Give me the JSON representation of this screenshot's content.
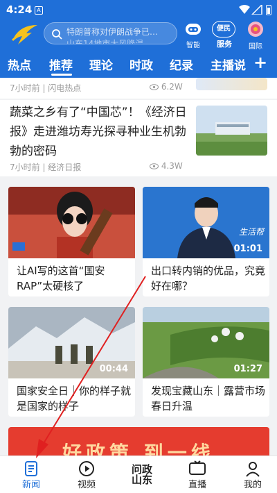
{
  "status_bar": {
    "time": "4:24",
    "notification_glyph": "A"
  },
  "header": {
    "search_placeholder": "特朗普称对伊朗战争已…",
    "search_placeholder_line2": "山东14地市大风降温…",
    "shortcuts": [
      {
        "label": "智能",
        "icon": "robot-icon"
      },
      {
        "label": "服务",
        "badge_text": "便民",
        "icon": "service-icon"
      },
      {
        "label": "国际",
        "icon": "globe-flower-icon"
      }
    ],
    "tabs": [
      "热点",
      "推荐",
      "理论",
      "时政",
      "纪录",
      "主播说"
    ],
    "active_tab": "推荐",
    "accent_color": "#1f6fd8"
  },
  "feed": {
    "partial_item": {
      "meta": "7小时前 | 闪电热点",
      "views": "6.2W"
    },
    "article": {
      "title": "蔬菜之乡有了“中国芯”！《经济日报》走进潍坊寿光探寻种业生机勃勃的密码",
      "meta": "7小时前 | 经济日报",
      "views": "4.3W"
    },
    "video_grid": [
      {
        "title": "让AI写的这首“国安RAP”太硬核了",
        "duration": ""
      },
      {
        "title": "出口转内销的优品，究竟好在哪？",
        "duration": "01:01",
        "overlay_text": "生活帮"
      },
      {
        "title": "国家安全日｜你的样子就是国家的样子",
        "duration": "00:44"
      },
      {
        "title": "发现宝藏山东｜露营市场春日升温",
        "duration": "01:27"
      }
    ],
    "banner_text": "好政策 到一线"
  },
  "bottom_nav": [
    {
      "label": "新闻",
      "icon": "news-icon",
      "active": true
    },
    {
      "label": "视频",
      "icon": "play-icon",
      "active": false
    },
    {
      "label": "问政山东",
      "icon": "wenzheng-icon",
      "active": false
    },
    {
      "label": "直播",
      "icon": "live-tv-icon",
      "active": false
    },
    {
      "label": "我的",
      "icon": "user-icon",
      "active": false
    }
  ]
}
